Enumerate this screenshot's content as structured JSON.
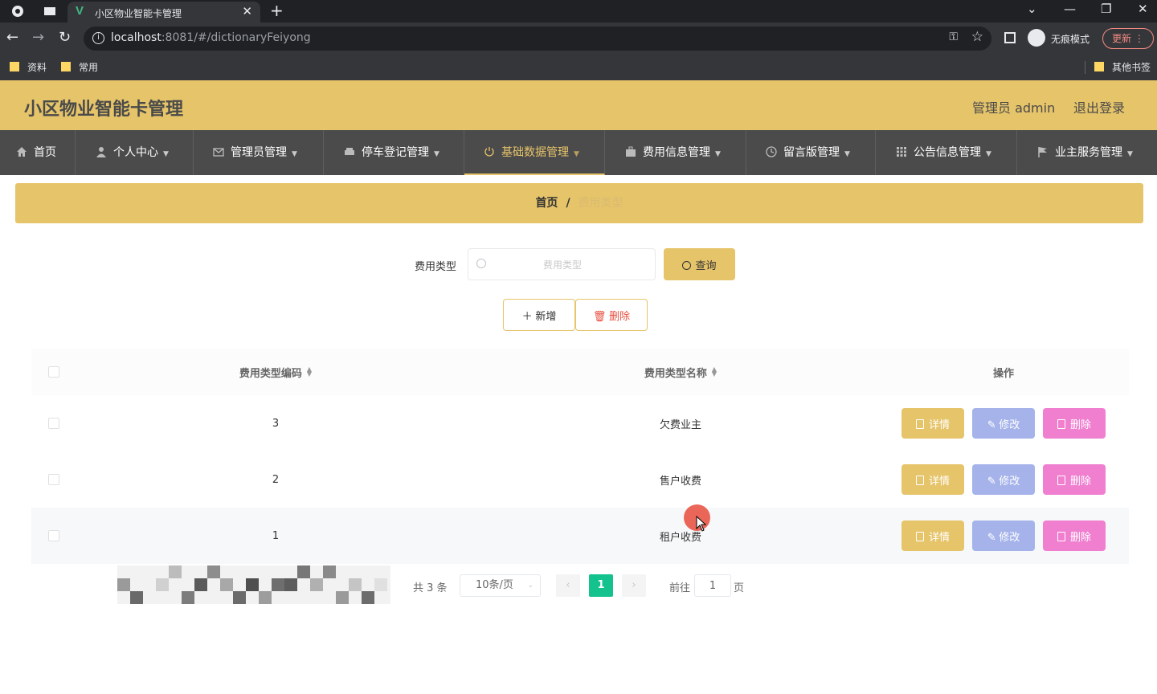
{
  "browser": {
    "tab_title": "小区物业智能卡管理",
    "tab_favicon": "V",
    "url_host": "localhost",
    "url_path": ":8081/#/dictionaryFeiyong",
    "incognito_label": "无痕模式",
    "update_label": "更新",
    "bookmarks": [
      "资料",
      "常用"
    ],
    "other_bookmarks": "其他书签"
  },
  "header": {
    "title": "小区物业智能卡管理",
    "admin_label": "管理员 admin",
    "logout": "退出登录"
  },
  "menu": [
    {
      "label": "首页",
      "icon": "home-icon",
      "active": false
    },
    {
      "label": "个人中心",
      "icon": "user-icon",
      "active": false
    },
    {
      "label": "管理员管理",
      "icon": "mail-icon",
      "active": false
    },
    {
      "label": "停车登记管理",
      "icon": "car-icon",
      "active": false
    },
    {
      "label": "基础数据管理",
      "icon": "power-icon",
      "active": true
    },
    {
      "label": "费用信息管理",
      "icon": "briefcase-icon",
      "active": false
    },
    {
      "label": "留言版管理",
      "icon": "clock-icon",
      "active": false
    },
    {
      "label": "公告信息管理",
      "icon": "grid-icon",
      "active": false
    },
    {
      "label": "业主服务管理",
      "icon": "flag-icon",
      "active": false
    }
  ],
  "breadcrumb": {
    "home": "首页",
    "separator": "/",
    "current": "费用类型"
  },
  "search": {
    "label": "费用类型",
    "placeholder": "费用类型",
    "value": "",
    "query_button": "查询"
  },
  "actions": {
    "add": "新增",
    "delete": "删除"
  },
  "table": {
    "columns": [
      "费用类型编码",
      "费用类型名称",
      "操作"
    ],
    "rows": [
      {
        "code": "3",
        "name": "欠费业主"
      },
      {
        "code": "2",
        "name": "售户收费"
      },
      {
        "code": "1",
        "name": "租户收费"
      }
    ],
    "row_actions": {
      "detail": "详情",
      "edit": "修改",
      "delete": "删除"
    }
  },
  "pagination": {
    "total": "共 3 条",
    "page_size": "10条/页",
    "current_page": "1",
    "goto_label": "前往",
    "goto_value": "1",
    "page_suffix": "页"
  },
  "colors": {
    "theme": "#e6c46a",
    "menu_bg": "#4b4b4b",
    "edit_button": "#a5b3ea",
    "delete_button": "#f07fd0",
    "page_active": "#13c28c"
  }
}
